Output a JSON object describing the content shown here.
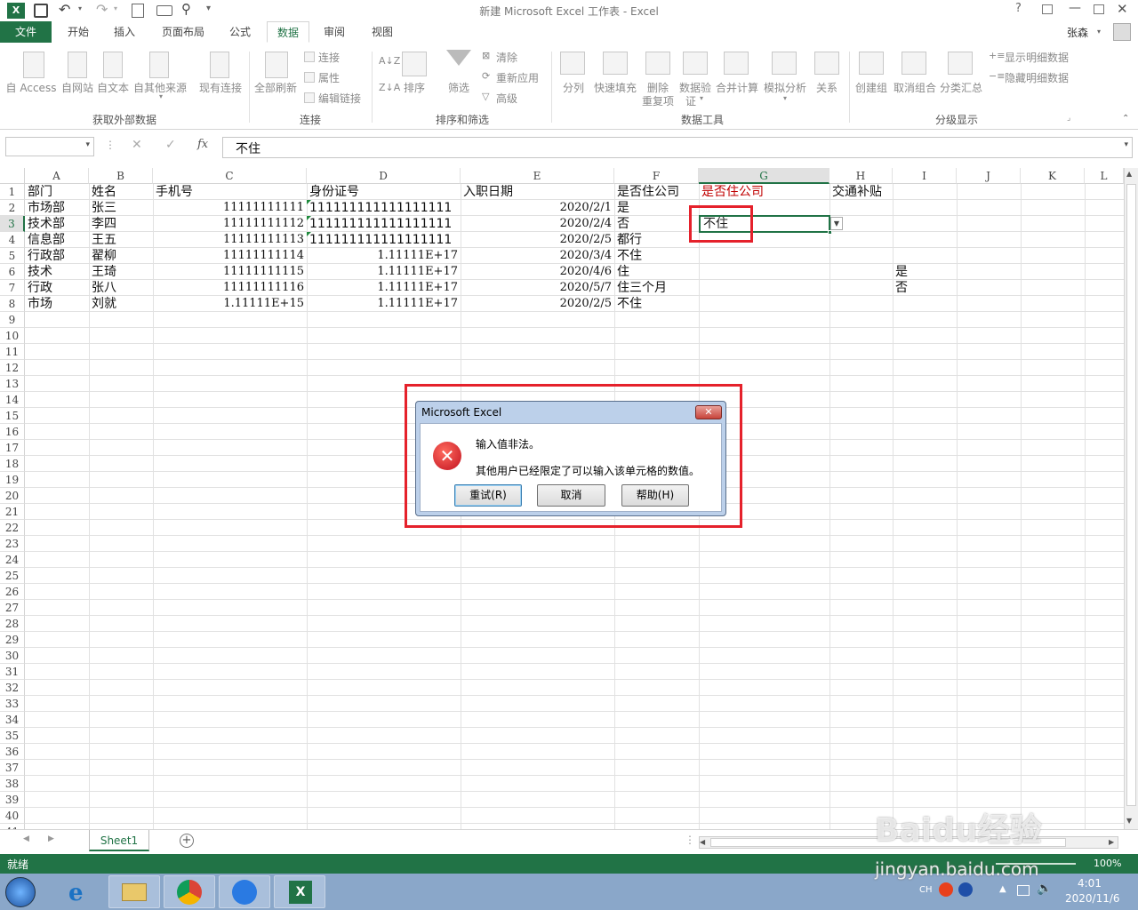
{
  "window": {
    "title": "新建 Microsoft Excel 工作表 - Excel",
    "user": "张森"
  },
  "qat": {
    "excel_icon": "excel-logo",
    "save_icon": "save-icon",
    "undo_icon": "undo-icon",
    "redo_icon": "redo-icon",
    "preview_icon": "print-preview-icon",
    "camera_icon": "camera-icon",
    "find_icon": "binoculars-icon"
  },
  "tabs": [
    {
      "label": "文件",
      "active": false,
      "file": true
    },
    {
      "label": "开始"
    },
    {
      "label": "插入"
    },
    {
      "label": "页面布局"
    },
    {
      "label": "公式"
    },
    {
      "label": "数据",
      "active": true
    },
    {
      "label": "审阅"
    },
    {
      "label": "视图"
    }
  ],
  "ribbon": {
    "get_external": {
      "group": "获取外部数据",
      "access": "自 Access",
      "web": "自网站",
      "text": "自文本",
      "other": "自其他来源",
      "existing": "现有连接"
    },
    "connections": {
      "group": "连接",
      "refresh_all": "全部刷新",
      "connections": "连接",
      "properties": "属性",
      "edit_links": "编辑链接"
    },
    "sort_filter": {
      "group": "排序和筛选",
      "sort": "排序",
      "filter": "筛选",
      "clear": "清除",
      "reapply": "重新应用",
      "advanced": "高级"
    },
    "data_tools": {
      "group": "数据工具",
      "text_to_columns": "分列",
      "flash_fill": "快速填充",
      "remove_dup1": "删除",
      "remove_dup2": "重复项",
      "validation1": "数据验",
      "validation2": "证",
      "consolidate": "合并计算",
      "what_if": "模拟分析",
      "relationships": "关系"
    },
    "outline": {
      "group": "分级显示",
      "group_btn": "创建组",
      "ungroup": "取消组合",
      "subtotal": "分类汇总",
      "show_detail": "显示明细数据",
      "hide_detail": "隐藏明细数据"
    }
  },
  "formula_bar": {
    "name_box": "",
    "fx": "fx",
    "value": "不住"
  },
  "columns": [
    "A",
    "B",
    "C",
    "D",
    "E",
    "F",
    "G",
    "H",
    "I",
    "J",
    "K",
    "L"
  ],
  "rows": [
    "1",
    "2",
    "3",
    "4",
    "5",
    "6",
    "7",
    "8",
    "9",
    "10",
    "11",
    "12",
    "13",
    "14",
    "15",
    "16",
    "17",
    "18",
    "19",
    "20",
    "21",
    "22",
    "23",
    "24",
    "25",
    "26",
    "27",
    "28",
    "29",
    "30",
    "31",
    "32",
    "33",
    "34",
    "35",
    "36",
    "37",
    "38",
    "39",
    "40",
    "41"
  ],
  "cells": {
    "header": [
      "部门",
      "姓名",
      "手机号",
      "身份证号",
      "入职日期",
      "是否住公司",
      "是否住公司",
      "交通补贴"
    ],
    "data": [
      [
        "市场部",
        "张三",
        "11111111111",
        "111111111111111111",
        "2020/2/1",
        "是"
      ],
      [
        "技术部",
        "李四",
        "11111111112",
        "111111111111111111",
        "2020/2/4",
        "否"
      ],
      [
        "信息部",
        "王五",
        "11111111113",
        "111111111111111111",
        "2020/2/5",
        "都行"
      ],
      [
        "行政部",
        "翟柳",
        "11111111114",
        "1.11111E+17",
        "2020/3/4",
        "不住"
      ],
      [
        "技术",
        "王琦",
        "11111111115",
        "1.11111E+17",
        "2020/4/6",
        "住"
      ],
      [
        "行政",
        "张八",
        "11111111116",
        "1.11111E+17",
        "2020/5/7",
        "住三个月"
      ],
      [
        "市场",
        "刘就",
        "1.11111E+15",
        "1.11111E+17",
        "2020/2/5",
        "不住"
      ]
    ],
    "g3_edit": "不住",
    "i6": "是",
    "i7": "否"
  },
  "colors": {
    "accent": "#217346",
    "highlight_red": "#e5212b",
    "header_red": "#c00000"
  },
  "sheet_tabs": [
    "Sheet1"
  ],
  "status": {
    "ready": "就绪",
    "zoom": "100%"
  },
  "dialog": {
    "title": "Microsoft Excel",
    "message": "输入值非法。",
    "detail": "其他用户已经限定了可以输入该单元格的数值。",
    "retry": "重试(R)",
    "cancel": "取消",
    "help": "帮助(H)",
    "icon": "error-icon"
  },
  "taskbar": {
    "apps": [
      "windows-start-icon",
      "ie-icon",
      "explorer-icon",
      "chrome-icon",
      "feishu-icon",
      "excel-icon"
    ],
    "lang": "CH",
    "time": "4:01",
    "date": "2020/11/6"
  },
  "watermark": {
    "text": "Baidu经验",
    "url": "jingyan.baidu.com"
  }
}
